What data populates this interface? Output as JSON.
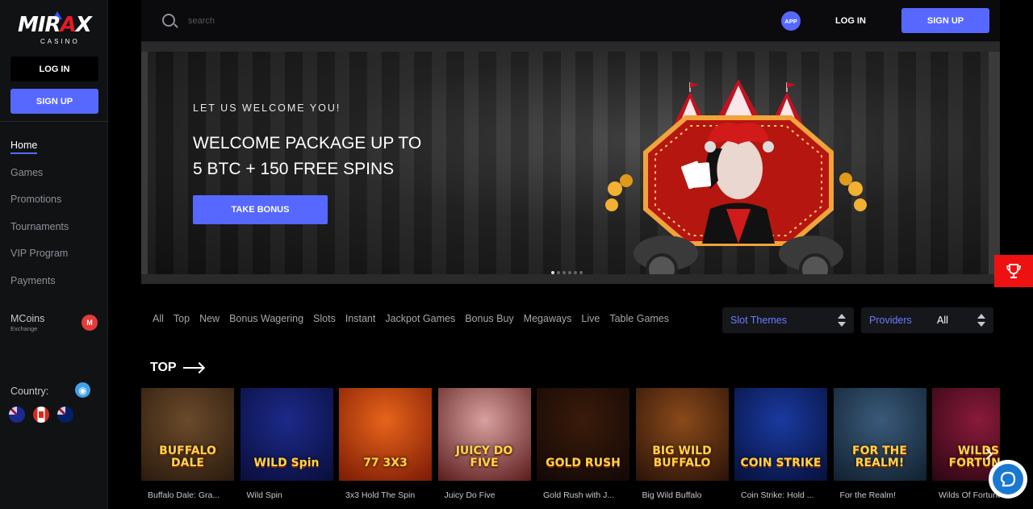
{
  "brand": {
    "name_left": "MIR",
    "name_x": "A",
    "name_right": "X",
    "sub": "CASINO"
  },
  "sidebar": {
    "login_label": "LOG IN",
    "signup_label": "SIGN UP",
    "nav": [
      {
        "label": "Home",
        "active": true
      },
      {
        "label": "Games"
      },
      {
        "label": "Promotions"
      },
      {
        "label": "Tournaments"
      },
      {
        "label": "VIP Program"
      },
      {
        "label": "Payments"
      }
    ],
    "mcoins": {
      "title": "MCoins",
      "subtitle": "Exchange",
      "badge": "M"
    },
    "country_label": "Country:"
  },
  "header": {
    "search_placeholder": "search",
    "app_label": "APP",
    "login_label": "LOG IN",
    "signup_label": "SIGN UP"
  },
  "banner": {
    "eyebrow": "LET US WELCOME YOU!",
    "title_line1": "WELCOME PACKAGE UP TO",
    "title_line2": "5 BTC + 150 FREE SPINS",
    "button_label": "TAKE BONUS",
    "slides": 6,
    "active_slide": 1
  },
  "filters": {
    "categories": [
      "All",
      "Top",
      "New",
      "Bonus Wagering",
      "Slots",
      "Instant",
      "Jackpot Games",
      "Bonus Buy",
      "Megaways",
      "Live",
      "Table Games"
    ],
    "themes_label": "Slot Themes",
    "providers_label": "Providers",
    "providers_value": "All"
  },
  "top_section": {
    "title": "TOP"
  },
  "games": [
    {
      "name": "Buffalo Dale: Gra...",
      "art": "BUFFALO DALE",
      "bg1": "#6b4a2a",
      "bg2": "#2a1a0e"
    },
    {
      "name": "Wild Spin",
      "art": "WILD Spin",
      "bg1": "#1c2a8a",
      "bg2": "#0a0d3a"
    },
    {
      "name": "3x3 Hold The Spin",
      "art": "77 3X3",
      "bg1": "#e8641a",
      "bg2": "#7a1a05"
    },
    {
      "name": "Juicy Do Five",
      "art": "JUICY DO FIVE",
      "bg1": "#d8a0a0",
      "bg2": "#5a1a1a"
    },
    {
      "name": "Gold Rush with J...",
      "art": "GOLD RUSH",
      "bg1": "#3a1a0a",
      "bg2": "#120806"
    },
    {
      "name": "Big Wild Buffalo",
      "art": "BIG WILD BUFFALO",
      "bg1": "#8a4a1a",
      "bg2": "#2a1208"
    },
    {
      "name": "Coin Strike: Hold ...",
      "art": "COIN STRIKE",
      "bg1": "#1a3aa0",
      "bg2": "#06103a"
    },
    {
      "name": "For the Realm!",
      "art": "FOR THE REALM!",
      "bg1": "#3a5a7a",
      "bg2": "#10202e"
    },
    {
      "name": "Wilds Of Fortune",
      "art": "WILDS FORTUNE",
      "bg1": "#8a1a3a",
      "bg2": "#2a0612"
    }
  ]
}
